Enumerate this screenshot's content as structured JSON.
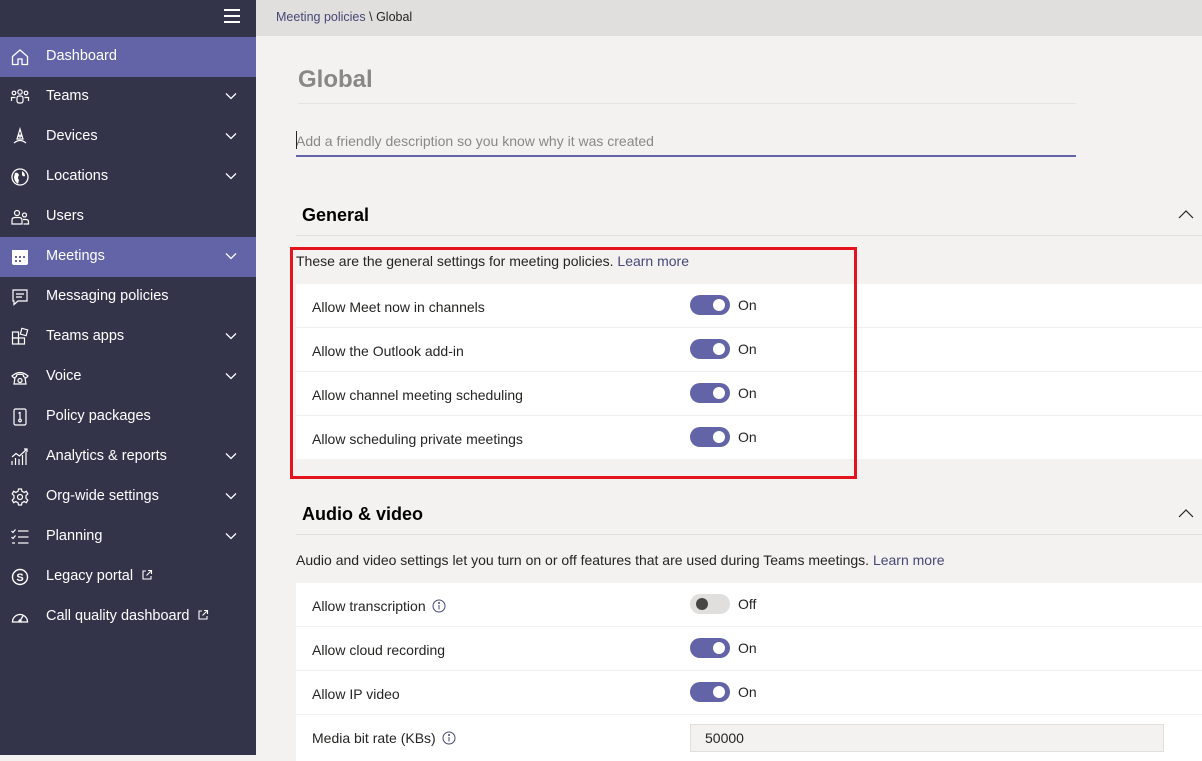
{
  "sidebar": {
    "items": [
      {
        "label": "Dashboard",
        "icon": "home-icon",
        "active": true,
        "chevron": false
      },
      {
        "label": "Teams",
        "icon": "teams-icon",
        "active": false,
        "chevron": true
      },
      {
        "label": "Devices",
        "icon": "devices-icon",
        "active": false,
        "chevron": true
      },
      {
        "label": "Locations",
        "icon": "globe-icon",
        "active": false,
        "chevron": true
      },
      {
        "label": "Users",
        "icon": "users-icon",
        "active": false,
        "chevron": false
      },
      {
        "label": "Meetings",
        "icon": "calendar-icon",
        "active": true,
        "chevron": true
      },
      {
        "label": "Messaging policies",
        "icon": "message-icon",
        "active": false,
        "chevron": false
      },
      {
        "label": "Teams apps",
        "icon": "apps-icon",
        "active": false,
        "chevron": true
      },
      {
        "label": "Voice",
        "icon": "phone-icon",
        "active": false,
        "chevron": true
      },
      {
        "label": "Policy packages",
        "icon": "package-icon",
        "active": false,
        "chevron": false
      },
      {
        "label": "Analytics & reports",
        "icon": "analytics-icon",
        "active": false,
        "chevron": true
      },
      {
        "label": "Org-wide settings",
        "icon": "gear-icon",
        "active": false,
        "chevron": true
      },
      {
        "label": "Planning",
        "icon": "checklist-icon",
        "active": false,
        "chevron": true
      },
      {
        "label": "Legacy portal",
        "icon": "skype-icon",
        "active": false,
        "chevron": false,
        "external": true
      },
      {
        "label": "Call quality dashboard",
        "icon": "gauge-icon",
        "active": false,
        "chevron": false,
        "external": true
      }
    ]
  },
  "breadcrumb": {
    "parent": "Meeting policies",
    "separator": " \\ ",
    "current": "Global"
  },
  "page": {
    "title": "Global",
    "description_placeholder": "Add a friendly description so you know why it was created"
  },
  "general": {
    "heading": "General",
    "description": "These are the general settings for meeting policies.",
    "learn_more": "Learn more",
    "settings": [
      {
        "label": "Allow Meet now in channels",
        "state": "On"
      },
      {
        "label": "Allow the Outlook add-in",
        "state": "On"
      },
      {
        "label": "Allow channel meeting scheduling",
        "state": "On"
      },
      {
        "label": "Allow scheduling private meetings",
        "state": "On"
      }
    ]
  },
  "audio_video": {
    "heading": "Audio & video",
    "description": "Audio and video settings let you turn on or off features that are used during Teams meetings.",
    "learn_more": "Learn more",
    "settings": [
      {
        "label": "Allow transcription",
        "state": "Off",
        "info": true
      },
      {
        "label": "Allow cloud recording",
        "state": "On"
      },
      {
        "label": "Allow IP video",
        "state": "On"
      },
      {
        "label": "Media bit rate (KBs)",
        "value": "50000",
        "info": true
      }
    ]
  },
  "colors": {
    "accent": "#6264a7",
    "sidebar": "#33344a",
    "highlight": "#e3141e"
  }
}
